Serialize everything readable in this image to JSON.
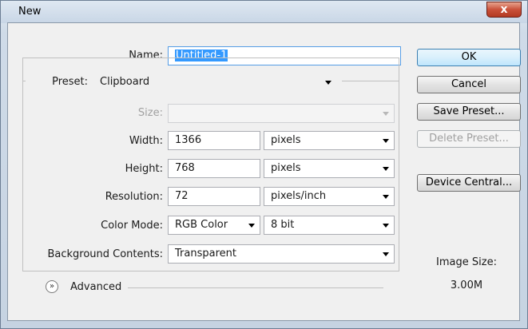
{
  "window": {
    "title": "New",
    "close_glyph": "x"
  },
  "form": {
    "name": {
      "label": "Name:",
      "value": "Untitled-1"
    },
    "preset": {
      "label": "Preset:",
      "value": "Clipboard"
    },
    "size": {
      "label": "Size:",
      "value": ""
    },
    "width": {
      "label": "Width:",
      "value": "1366",
      "unit": "pixels"
    },
    "height": {
      "label": "Height:",
      "value": "768",
      "unit": "pixels"
    },
    "resolution": {
      "label": "Resolution:",
      "value": "72",
      "unit": "pixels/inch"
    },
    "color_mode": {
      "label": "Color Mode:",
      "value": "RGB Color",
      "depth": "8 bit"
    },
    "background": {
      "label": "Background Contents:",
      "value": "Transparent"
    },
    "advanced": {
      "label": "Advanced",
      "icon": "double-chevron-down-icon"
    }
  },
  "buttons": {
    "ok": "OK",
    "cancel": "Cancel",
    "save_preset": "Save Preset...",
    "delete_preset": "Delete Preset...",
    "device_central": "Device Central..."
  },
  "image_size": {
    "label": "Image Size:",
    "value": "3.00M"
  }
}
